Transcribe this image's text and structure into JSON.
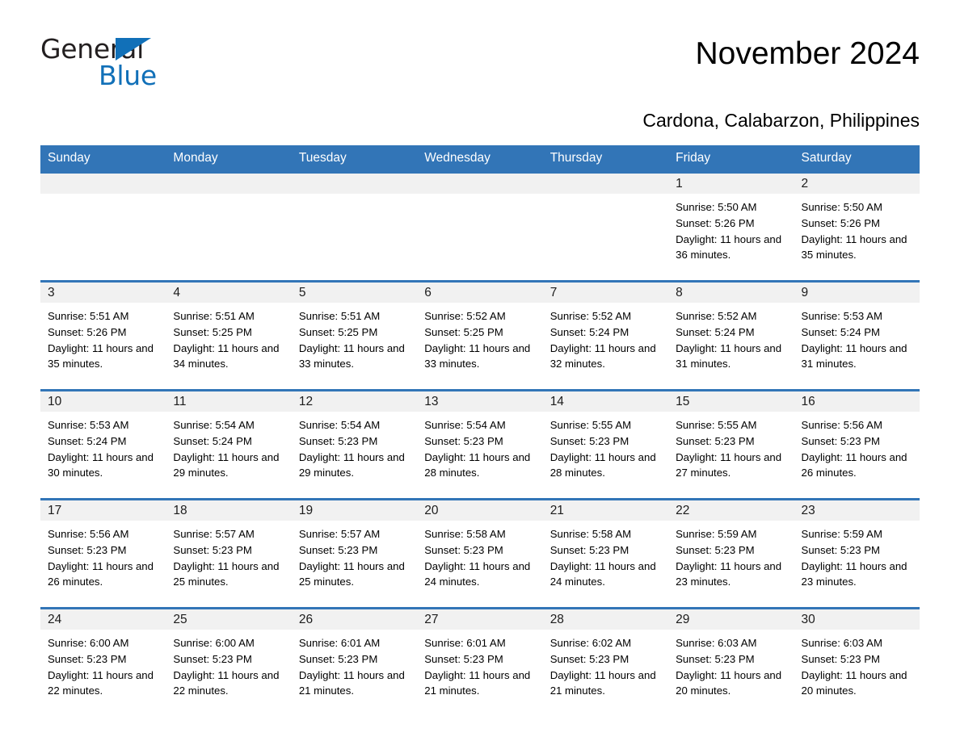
{
  "brand": {
    "name_part1": "General",
    "name_part2": "Blue",
    "accent_color": "#1170b8"
  },
  "header": {
    "month_title": "November 2024",
    "location": "Cardona, Calabarzon, Philippines"
  },
  "theme": {
    "header_bar_color": "#3275b7",
    "date_band_color": "#f1f1f1",
    "row_divider_color": "#3275b7"
  },
  "weekdays": [
    "Sunday",
    "Monday",
    "Tuesday",
    "Wednesday",
    "Thursday",
    "Friday",
    "Saturday"
  ],
  "weeks": [
    [
      {
        "day": "",
        "sunrise": "",
        "sunset": "",
        "daylight": ""
      },
      {
        "day": "",
        "sunrise": "",
        "sunset": "",
        "daylight": ""
      },
      {
        "day": "",
        "sunrise": "",
        "sunset": "",
        "daylight": ""
      },
      {
        "day": "",
        "sunrise": "",
        "sunset": "",
        "daylight": ""
      },
      {
        "day": "",
        "sunrise": "",
        "sunset": "",
        "daylight": ""
      },
      {
        "day": "1",
        "sunrise": "Sunrise: 5:50 AM",
        "sunset": "Sunset: 5:26 PM",
        "daylight": "Daylight: 11 hours and 36 minutes."
      },
      {
        "day": "2",
        "sunrise": "Sunrise: 5:50 AM",
        "sunset": "Sunset: 5:26 PM",
        "daylight": "Daylight: 11 hours and 35 minutes."
      }
    ],
    [
      {
        "day": "3",
        "sunrise": "Sunrise: 5:51 AM",
        "sunset": "Sunset: 5:26 PM",
        "daylight": "Daylight: 11 hours and 35 minutes."
      },
      {
        "day": "4",
        "sunrise": "Sunrise: 5:51 AM",
        "sunset": "Sunset: 5:25 PM",
        "daylight": "Daylight: 11 hours and 34 minutes."
      },
      {
        "day": "5",
        "sunrise": "Sunrise: 5:51 AM",
        "sunset": "Sunset: 5:25 PM",
        "daylight": "Daylight: 11 hours and 33 minutes."
      },
      {
        "day": "6",
        "sunrise": "Sunrise: 5:52 AM",
        "sunset": "Sunset: 5:25 PM",
        "daylight": "Daylight: 11 hours and 33 minutes."
      },
      {
        "day": "7",
        "sunrise": "Sunrise: 5:52 AM",
        "sunset": "Sunset: 5:24 PM",
        "daylight": "Daylight: 11 hours and 32 minutes."
      },
      {
        "day": "8",
        "sunrise": "Sunrise: 5:52 AM",
        "sunset": "Sunset: 5:24 PM",
        "daylight": "Daylight: 11 hours and 31 minutes."
      },
      {
        "day": "9",
        "sunrise": "Sunrise: 5:53 AM",
        "sunset": "Sunset: 5:24 PM",
        "daylight": "Daylight: 11 hours and 31 minutes."
      }
    ],
    [
      {
        "day": "10",
        "sunrise": "Sunrise: 5:53 AM",
        "sunset": "Sunset: 5:24 PM",
        "daylight": "Daylight: 11 hours and 30 minutes."
      },
      {
        "day": "11",
        "sunrise": "Sunrise: 5:54 AM",
        "sunset": "Sunset: 5:24 PM",
        "daylight": "Daylight: 11 hours and 29 minutes."
      },
      {
        "day": "12",
        "sunrise": "Sunrise: 5:54 AM",
        "sunset": "Sunset: 5:23 PM",
        "daylight": "Daylight: 11 hours and 29 minutes."
      },
      {
        "day": "13",
        "sunrise": "Sunrise: 5:54 AM",
        "sunset": "Sunset: 5:23 PM",
        "daylight": "Daylight: 11 hours and 28 minutes."
      },
      {
        "day": "14",
        "sunrise": "Sunrise: 5:55 AM",
        "sunset": "Sunset: 5:23 PM",
        "daylight": "Daylight: 11 hours and 28 minutes."
      },
      {
        "day": "15",
        "sunrise": "Sunrise: 5:55 AM",
        "sunset": "Sunset: 5:23 PM",
        "daylight": "Daylight: 11 hours and 27 minutes."
      },
      {
        "day": "16",
        "sunrise": "Sunrise: 5:56 AM",
        "sunset": "Sunset: 5:23 PM",
        "daylight": "Daylight: 11 hours and 26 minutes."
      }
    ],
    [
      {
        "day": "17",
        "sunrise": "Sunrise: 5:56 AM",
        "sunset": "Sunset: 5:23 PM",
        "daylight": "Daylight: 11 hours and 26 minutes."
      },
      {
        "day": "18",
        "sunrise": "Sunrise: 5:57 AM",
        "sunset": "Sunset: 5:23 PM",
        "daylight": "Daylight: 11 hours and 25 minutes."
      },
      {
        "day": "19",
        "sunrise": "Sunrise: 5:57 AM",
        "sunset": "Sunset: 5:23 PM",
        "daylight": "Daylight: 11 hours and 25 minutes."
      },
      {
        "day": "20",
        "sunrise": "Sunrise: 5:58 AM",
        "sunset": "Sunset: 5:23 PM",
        "daylight": "Daylight: 11 hours and 24 minutes."
      },
      {
        "day": "21",
        "sunrise": "Sunrise: 5:58 AM",
        "sunset": "Sunset: 5:23 PM",
        "daylight": "Daylight: 11 hours and 24 minutes."
      },
      {
        "day": "22",
        "sunrise": "Sunrise: 5:59 AM",
        "sunset": "Sunset: 5:23 PM",
        "daylight": "Daylight: 11 hours and 23 minutes."
      },
      {
        "day": "23",
        "sunrise": "Sunrise: 5:59 AM",
        "sunset": "Sunset: 5:23 PM",
        "daylight": "Daylight: 11 hours and 23 minutes."
      }
    ],
    [
      {
        "day": "24",
        "sunrise": "Sunrise: 6:00 AM",
        "sunset": "Sunset: 5:23 PM",
        "daylight": "Daylight: 11 hours and 22 minutes."
      },
      {
        "day": "25",
        "sunrise": "Sunrise: 6:00 AM",
        "sunset": "Sunset: 5:23 PM",
        "daylight": "Daylight: 11 hours and 22 minutes."
      },
      {
        "day": "26",
        "sunrise": "Sunrise: 6:01 AM",
        "sunset": "Sunset: 5:23 PM",
        "daylight": "Daylight: 11 hours and 21 minutes."
      },
      {
        "day": "27",
        "sunrise": "Sunrise: 6:01 AM",
        "sunset": "Sunset: 5:23 PM",
        "daylight": "Daylight: 11 hours and 21 minutes."
      },
      {
        "day": "28",
        "sunrise": "Sunrise: 6:02 AM",
        "sunset": "Sunset: 5:23 PM",
        "daylight": "Daylight: 11 hours and 21 minutes."
      },
      {
        "day": "29",
        "sunrise": "Sunrise: 6:03 AM",
        "sunset": "Sunset: 5:23 PM",
        "daylight": "Daylight: 11 hours and 20 minutes."
      },
      {
        "day": "30",
        "sunrise": "Sunrise: 6:03 AM",
        "sunset": "Sunset: 5:23 PM",
        "daylight": "Daylight: 11 hours and 20 minutes."
      }
    ]
  ]
}
